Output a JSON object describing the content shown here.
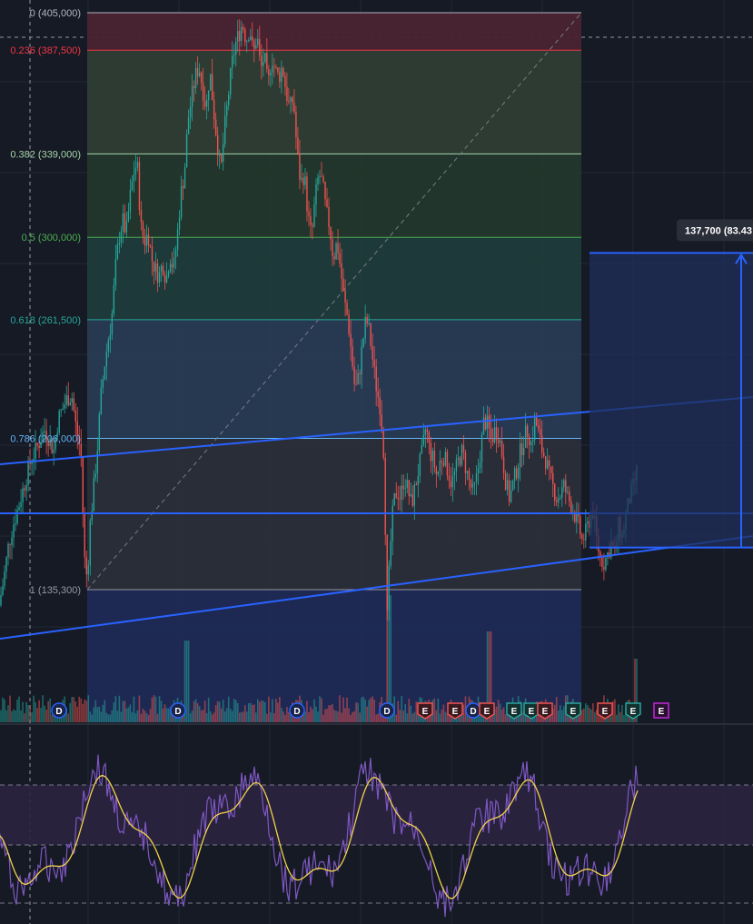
{
  "colors": {
    "background": "#161a25",
    "grid": "#232836",
    "candle_up": "#26a69a",
    "candle_down": "#ef5350",
    "trendline": "#2962ff",
    "osc_line": "#7e57c2",
    "osc_signal": "#f2d24a",
    "osc_band_fill": "#2a2440",
    "measure_fill": "#1f2f5a",
    "badge_dividend": "#2962ff",
    "badge_earnings_down": "#ef5350",
    "badge_earnings_up": "#26a69a",
    "badge_earnings_future": "#c327d8"
  },
  "chart_data": [
    {
      "type": "candlestick",
      "price_range": [
        90000,
        405000
      ],
      "fib_retracement": [
        {
          "ratio": "0",
          "price": 405000,
          "label": "0 (405,000)",
          "color": "#b2b5be",
          "zone_fill": "#4a2330"
        },
        {
          "ratio": "0.236",
          "price": 387500,
          "label": "0.236 (387,500)",
          "color": "#f23645",
          "zone_fill": "#4a2330"
        },
        {
          "ratio": "0.382",
          "price": 339000,
          "label": "0.382 (339,000)",
          "color": "#a5d6a7",
          "zone_fill": "#2e3d34"
        },
        {
          "ratio": "0.5",
          "price": 300000,
          "label": "0.5 (300,000)",
          "color": "#4caf50",
          "zone_fill": "#23372c"
        },
        {
          "ratio": "0.618",
          "price": 261500,
          "label": "0.618 (261,500)",
          "color": "#26a69a",
          "zone_fill": "#1f3b3a"
        },
        {
          "ratio": "0.786",
          "price": 206000,
          "label": "0.786 (206,000)",
          "color": "#64b5f6",
          "zone_fill": "#283b52"
        },
        {
          "ratio": "1",
          "price": 135300,
          "label": "1 (135,300)",
          "color": "#9598a1",
          "zone_fill": "#2a2e39"
        }
      ],
      "price_path": [
        [
          0,
          128000
        ],
        [
          5,
          140000
        ],
        [
          10,
          155000
        ],
        [
          15,
          165000
        ],
        [
          20,
          172000
        ],
        [
          25,
          180000
        ],
        [
          30,
          188000
        ],
        [
          35,
          196000
        ],
        [
          40,
          200000
        ],
        [
          45,
          205000
        ],
        [
          50,
          210000
        ],
        [
          55,
          206000
        ],
        [
          60,
          200000
        ],
        [
          65,
          215000
        ],
        [
          70,
          220000
        ],
        [
          75,
          225000
        ],
        [
          80,
          226000
        ],
        [
          85,
          210000
        ],
        [
          90,
          200000
        ],
        [
          94,
          150000
        ],
        [
          97,
          140000
        ],
        [
          100,
          165000
        ],
        [
          104,
          182000
        ],
        [
          108,
          200000
        ],
        [
          112,
          225000
        ],
        [
          116,
          240000
        ],
        [
          120,
          252000
        ],
        [
          124,
          262000
        ],
        [
          128,
          285000
        ],
        [
          132,
          300000
        ],
        [
          136,
          308000
        ],
        [
          140,
          302000
        ],
        [
          144,
          318000
        ],
        [
          148,
          330000
        ],
        [
          152,
          335000
        ],
        [
          156,
          305000
        ],
        [
          160,
          298000
        ],
        [
          164,
          302000
        ],
        [
          168,
          290000
        ],
        [
          172,
          285000
        ],
        [
          176,
          282000
        ],
        [
          180,
          288000
        ],
        [
          184,
          280000
        ],
        [
          188,
          292000
        ],
        [
          192,
          285000
        ],
        [
          196,
          300000
        ],
        [
          200,
          320000
        ],
        [
          204,
          330000
        ],
        [
          208,
          355000
        ],
        [
          212,
          365000
        ],
        [
          216,
          375000
        ],
        [
          220,
          380000
        ],
        [
          224,
          370000
        ],
        [
          228,
          360000
        ],
        [
          232,
          378000
        ],
        [
          236,
          360000
        ],
        [
          240,
          345000
        ],
        [
          244,
          330000
        ],
        [
          248,
          350000
        ],
        [
          252,
          365000
        ],
        [
          256,
          380000
        ],
        [
          260,
          390000
        ],
        [
          264,
          395000
        ],
        [
          268,
          400000
        ],
        [
          272,
          392000
        ],
        [
          276,
          398000
        ],
        [
          280,
          385000
        ],
        [
          284,
          395000
        ],
        [
          288,
          378000
        ],
        [
          292,
          385000
        ],
        [
          296,
          370000
        ],
        [
          300,
          385000
        ],
        [
          304,
          378000
        ],
        [
          308,
          375000
        ],
        [
          312,
          380000
        ],
        [
          316,
          368000
        ],
        [
          320,
          360000
        ],
        [
          324,
          365000
        ],
        [
          328,
          340000
        ],
        [
          332,
          325000
        ],
        [
          336,
          330000
        ],
        [
          340,
          310000
        ],
        [
          344,
          300000
        ],
        [
          348,
          318000
        ],
        [
          352,
          330000
        ],
        [
          356,
          325000
        ],
        [
          360,
          312000
        ],
        [
          364,
          305000
        ],
        [
          368,
          290000
        ],
        [
          372,
          298000
        ],
        [
          376,
          285000
        ],
        [
          380,
          270000
        ],
        [
          384,
          262000
        ],
        [
          388,
          245000
        ],
        [
          392,
          228000
        ],
        [
          396,
          235000
        ],
        [
          400,
          250000
        ],
        [
          404,
          262000
        ],
        [
          408,
          255000
        ],
        [
          412,
          240000
        ],
        [
          416,
          228000
        ],
        [
          420,
          220000
        ],
        [
          424,
          196000
        ],
        [
          427,
          120000
        ],
        [
          430,
          150000
        ],
        [
          434,
          175000
        ],
        [
          438,
          182000
        ],
        [
          442,
          178000
        ],
        [
          446,
          188000
        ],
        [
          450,
          182000
        ],
        [
          454,
          175000
        ],
        [
          458,
          183000
        ],
        [
          462,
          192000
        ],
        [
          466,
          200000
        ],
        [
          470,
          212000
        ],
        [
          474,
          200000
        ],
        [
          478,
          196000
        ],
        [
          482,
          188000
        ],
        [
          486,
          196000
        ],
        [
          490,
          198000
        ],
        [
          494,
          191000
        ],
        [
          498,
          185000
        ],
        [
          502,
          190000
        ],
        [
          506,
          196000
        ],
        [
          510,
          200000
        ],
        [
          514,
          192000
        ],
        [
          518,
          185000
        ],
        [
          522,
          180000
        ],
        [
          526,
          188000
        ],
        [
          530,
          200000
        ],
        [
          534,
          215000
        ],
        [
          538,
          212000
        ],
        [
          542,
          205000
        ],
        [
          546,
          210000
        ],
        [
          550,
          208000
        ],
        [
          554,
          198000
        ],
        [
          558,
          185000
        ],
        [
          562,
          178000
        ],
        [
          566,
          185000
        ],
        [
          570,
          192000
        ],
        [
          574,
          200000
        ],
        [
          578,
          206000
        ],
        [
          582,
          210000
        ],
        [
          586,
          203000
        ],
        [
          590,
          215000
        ],
        [
          594,
          208000
        ],
        [
          598,
          200000
        ],
        [
          602,
          196000
        ],
        [
          606,
          188000
        ],
        [
          610,
          183000
        ],
        [
          614,
          178000
        ],
        [
          618,
          180000
        ],
        [
          622,
          184000
        ],
        [
          626,
          178000
        ],
        [
          630,
          175000
        ],
        [
          634,
          170000
        ],
        [
          638,
          165000
        ],
        [
          642,
          158000
        ],
        [
          646,
          162000
        ],
        [
          650,
          168000
        ],
        [
          654,
          172000
        ],
        [
          658,
          158000
        ],
        [
          662,
          150000
        ],
        [
          666,
          148000
        ],
        [
          670,
          152000
        ],
        [
          674,
          157000
        ],
        [
          678,
          152000
        ],
        [
          682,
          165000
        ],
        [
          686,
          160000
        ],
        [
          690,
          170000
        ],
        [
          694,
          178000
        ],
        [
          698,
          183000
        ],
        [
          702,
          190000
        ]
      ],
      "measure": {
        "label": "137,700 (83.43",
        "from_price": 155000,
        "to_price": 292700
      }
    },
    {
      "type": "line",
      "series": [
        {
          "values": []
        },
        {
          "values": []
        }
      ]
    }
  ],
  "event_badges": [
    {
      "kind": "dividend",
      "text": "D"
    },
    {
      "kind": "dividend",
      "text": "D"
    },
    {
      "kind": "dividend",
      "text": "D"
    },
    {
      "kind": "dividend",
      "text": "D"
    },
    {
      "kind": "earnings-down",
      "text": "E"
    },
    {
      "kind": "earnings-down",
      "text": "E"
    },
    {
      "kind": "dividend",
      "text": "D"
    },
    {
      "kind": "earnings-down",
      "text": "E"
    },
    {
      "kind": "earnings-up",
      "text": "E"
    },
    {
      "kind": "earnings-up",
      "text": "E"
    },
    {
      "kind": "earnings-down",
      "text": "E"
    },
    {
      "kind": "earnings-up",
      "text": "E"
    },
    {
      "kind": "earnings-down",
      "text": "E"
    },
    {
      "kind": "earnings-up",
      "text": "E"
    },
    {
      "kind": "earnings-future",
      "text": "E"
    }
  ]
}
